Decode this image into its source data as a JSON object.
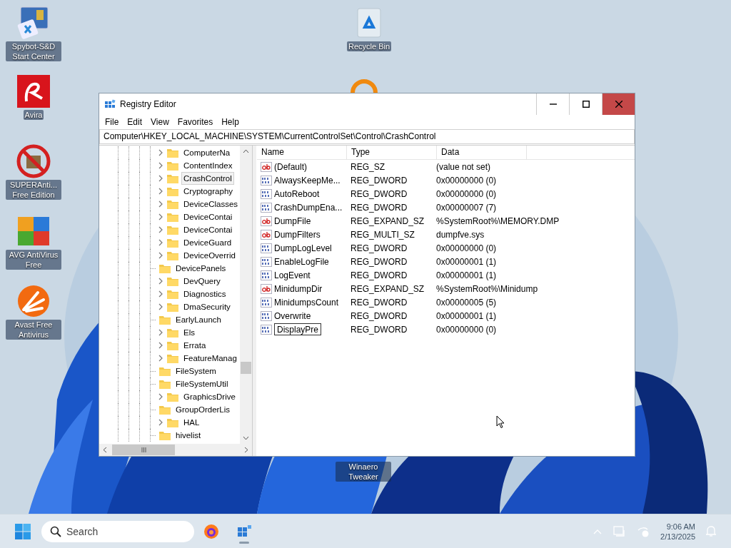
{
  "desktop_icons": [
    {
      "label": "Spybot-S&D Start Center",
      "kind": "spybot"
    },
    {
      "label": "Avira",
      "kind": "avira"
    },
    {
      "label": "SUPERAnti... Free Edition",
      "kind": "superanti"
    },
    {
      "label": "AVG AntiVirus Free",
      "kind": "avg"
    },
    {
      "label": "Avast Free Antivirus",
      "kind": "avast"
    },
    {
      "label": "Recycle Bin",
      "kind": "recycle"
    },
    {
      "label": "Winaero Tweaker",
      "kind": "winaero"
    }
  ],
  "window": {
    "title": "Registry Editor",
    "menu": [
      "File",
      "Edit",
      "View",
      "Favorites",
      "Help"
    ],
    "address": "Computer\\HKEY_LOCAL_MACHINE\\SYSTEM\\CurrentControlSet\\Control\\CrashControl",
    "tree": {
      "items": [
        {
          "label": "ComputerNa",
          "has_children": true,
          "selected": false
        },
        {
          "label": "ContentIndex",
          "has_children": true,
          "selected": false
        },
        {
          "label": "CrashControl",
          "has_children": true,
          "selected": true
        },
        {
          "label": "Cryptography",
          "has_children": true,
          "selected": false
        },
        {
          "label": "DeviceClasses",
          "has_children": true,
          "selected": false
        },
        {
          "label": "DeviceContai",
          "has_children": true,
          "selected": false
        },
        {
          "label": "DeviceContai",
          "has_children": true,
          "selected": false
        },
        {
          "label": "DeviceGuard",
          "has_children": true,
          "selected": false
        },
        {
          "label": "DeviceOverrid",
          "has_children": true,
          "selected": false
        },
        {
          "label": "DevicePanels",
          "has_children": false,
          "selected": false
        },
        {
          "label": "DevQuery",
          "has_children": true,
          "selected": false
        },
        {
          "label": "Diagnostics",
          "has_children": true,
          "selected": false
        },
        {
          "label": "DmaSecurity",
          "has_children": true,
          "selected": false
        },
        {
          "label": "EarlyLaunch",
          "has_children": false,
          "selected": false
        },
        {
          "label": "Els",
          "has_children": true,
          "selected": false
        },
        {
          "label": "Errata",
          "has_children": true,
          "selected": false
        },
        {
          "label": "FeatureManag",
          "has_children": true,
          "selected": false
        },
        {
          "label": "FileSystem",
          "has_children": false,
          "selected": false
        },
        {
          "label": "FileSystemUtil",
          "has_children": false,
          "selected": false
        },
        {
          "label": "GraphicsDrive",
          "has_children": true,
          "selected": false
        },
        {
          "label": "GroupOrderLis",
          "has_children": false,
          "selected": false
        },
        {
          "label": "HAL",
          "has_children": true,
          "selected": false
        },
        {
          "label": "hivelist",
          "has_children": false,
          "selected": false
        }
      ]
    },
    "values": {
      "columns": [
        "Name",
        "Type",
        "Data"
      ],
      "rows": [
        {
          "kind": "string",
          "name": "(Default)",
          "type": "REG_SZ",
          "data": "(value not set)",
          "editing": false
        },
        {
          "kind": "binary",
          "name": "AlwaysKeepMe...",
          "type": "REG_DWORD",
          "data": "0x00000000 (0)",
          "editing": false
        },
        {
          "kind": "binary",
          "name": "AutoReboot",
          "type": "REG_DWORD",
          "data": "0x00000000 (0)",
          "editing": false
        },
        {
          "kind": "binary",
          "name": "CrashDumpEna...",
          "type": "REG_DWORD",
          "data": "0x00000007 (7)",
          "editing": false
        },
        {
          "kind": "string",
          "name": "DumpFile",
          "type": "REG_EXPAND_SZ",
          "data": "%SystemRoot%\\MEMORY.DMP",
          "editing": false
        },
        {
          "kind": "string",
          "name": "DumpFilters",
          "type": "REG_MULTI_SZ",
          "data": "dumpfve.sys",
          "editing": false
        },
        {
          "kind": "binary",
          "name": "DumpLogLevel",
          "type": "REG_DWORD",
          "data": "0x00000000 (0)",
          "editing": false
        },
        {
          "kind": "binary",
          "name": "EnableLogFile",
          "type": "REG_DWORD",
          "data": "0x00000001 (1)",
          "editing": false
        },
        {
          "kind": "binary",
          "name": "LogEvent",
          "type": "REG_DWORD",
          "data": "0x00000001 (1)",
          "editing": false
        },
        {
          "kind": "string",
          "name": "MinidumpDir",
          "type": "REG_EXPAND_SZ",
          "data": "%SystemRoot%\\Minidump",
          "editing": false
        },
        {
          "kind": "binary",
          "name": "MinidumpsCount",
          "type": "REG_DWORD",
          "data": "0x00000005 (5)",
          "editing": false
        },
        {
          "kind": "binary",
          "name": "Overwrite",
          "type": "REG_DWORD",
          "data": "0x00000001 (1)",
          "editing": false
        },
        {
          "kind": "binary",
          "name": "DisplayPre",
          "type": "REG_DWORD",
          "data": "0x00000000 (0)",
          "editing": true
        }
      ]
    }
  },
  "taskbar": {
    "search": {
      "placeholder": "Search"
    },
    "apps": [
      {
        "kind": "firefox",
        "active": false
      },
      {
        "kind": "regedit",
        "active": true
      }
    ],
    "time": "9:06 AM",
    "date": "2/13/2025"
  }
}
